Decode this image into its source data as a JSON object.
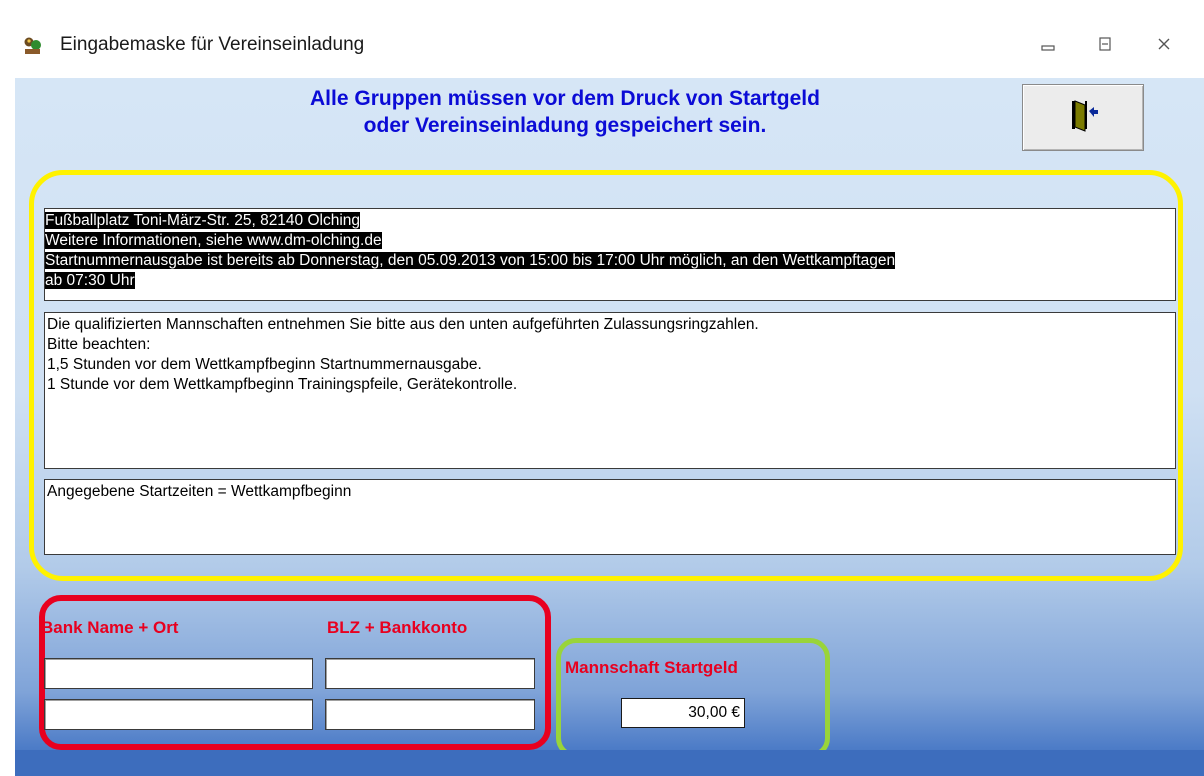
{
  "window": {
    "title": "Eingabemaske für Vereinseinladung",
    "icons": [
      "app-icon",
      "minimize-icon",
      "maximize-icon",
      "close-icon"
    ]
  },
  "banner": {
    "line1": "Alle Gruppen müssen vor dem Druck von Startgeld",
    "line2": "oder Vereinseinladung gespeichert sein.",
    "color": "#0b0bd6"
  },
  "exit_button": {
    "icon": "exit-door-icon"
  },
  "memo_location": {
    "lines": [
      "Fußballplatz Toni-März-Str. 25, 82140 Olching",
      "Weitere Informationen, siehe www.dm-olching.de",
      "Startnummernausgabe ist bereits ab Donnerstag, den 05.09.2013 von 15:00 bis 17:00 Uhr möglich, an den Wettkampftagen",
      "ab 07:30 Uhr"
    ]
  },
  "memo_notes": {
    "lines": [
      "Die qualifizierten Mannschaften entnehmen Sie bitte aus den unten aufgeführten Zulassungsringzahlen.",
      "Bitte beachten:",
      "1,5 Stunden vor dem Wettkampfbeginn Startnummernausgabe.",
      "1 Stunde vor dem Wettkampfbeginn Trainingspfeile, Gerätekontrolle."
    ]
  },
  "memo_start": {
    "lines": [
      "Angegebene Startzeiten = Wettkampfbeginn"
    ]
  },
  "bank": {
    "name_label": "Bank Name + Ort",
    "account_label": "BLZ +  Bankkonto",
    "name_line1": "",
    "name_line2": "",
    "account_line1": "",
    "account_line2": ""
  },
  "fee": {
    "label": "Mannschaft Startgeld",
    "value": "30,00 €"
  },
  "colors": {
    "highlight_yellow": "#fff200",
    "highlight_red": "#e8001f",
    "highlight_green": "#99d43a"
  }
}
